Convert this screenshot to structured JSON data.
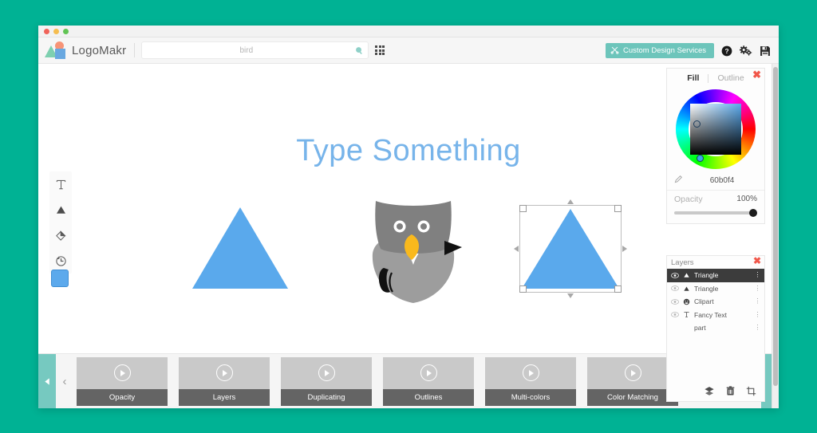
{
  "app": {
    "name": "LogoMakr",
    "window_controls": [
      "close",
      "minimize",
      "maximize"
    ]
  },
  "header": {
    "logo_text": "LogoMakr",
    "search": {
      "value": "bird",
      "placeholder": "bird"
    },
    "search_icon": "search-icon",
    "grid_icon": "grid-icon",
    "cds_button": {
      "label": "Custom Design Services",
      "icon": "scissors-icon",
      "color": "#6dc5bb"
    },
    "help_icon": "help-icon",
    "settings_icon": "gears-icon",
    "save_icon": "save-icon"
  },
  "toolbar": {
    "tools": [
      {
        "name": "text-tool",
        "glyph": "T"
      },
      {
        "name": "shapes-tool",
        "glyph": "triangle"
      },
      {
        "name": "fill-tool",
        "glyph": "paint"
      },
      {
        "name": "history-tool",
        "glyph": "clock"
      }
    ],
    "color_swatch": "#5ca9ec"
  },
  "canvas": {
    "heading": "Type Something",
    "heading_color": "#77b4ea",
    "shapes": [
      {
        "name": "triangle-left",
        "type": "triangle",
        "fill": "#5aa9ec",
        "selected": false
      },
      {
        "name": "owl-clipart",
        "type": "clipart",
        "fill": "#808080",
        "selected": false
      },
      {
        "name": "triangle-selected",
        "type": "triangle",
        "fill": "#5aa9ec",
        "selected": true
      }
    ]
  },
  "color_panel": {
    "tab_fill": "Fill",
    "tab_outline": "Outline",
    "active_tab": "Fill",
    "hex": "60b0f4",
    "opacity_label": "Opacity",
    "opacity_value": "100%",
    "close_label": "✖",
    "eyedropper_icon": "eyedropper-icon"
  },
  "layers_panel": {
    "title": "Layers",
    "close_label": "✖",
    "items": [
      {
        "name": "Triangle",
        "icon": "triangle-icon",
        "visible": true,
        "active": true
      },
      {
        "name": "Triangle",
        "icon": "triangle-icon",
        "visible": true,
        "active": false
      },
      {
        "name": "Clipart",
        "icon": "clipart-icon",
        "visible": true,
        "active": false
      },
      {
        "name": "Fancy Text",
        "icon": "text-icon",
        "visible": true,
        "active": false
      },
      {
        "name": "part",
        "icon": "clipart-icon",
        "visible": true,
        "active": false
      }
    ],
    "footer_icons": [
      "layers-stack-icon",
      "trash-icon",
      "crop-icon"
    ]
  },
  "tutorials": {
    "prev_label": "‹",
    "next_label": "›",
    "collapse_label": "◀",
    "cards": [
      {
        "label": "Opacity"
      },
      {
        "label": "Layers"
      },
      {
        "label": "Duplicating"
      },
      {
        "label": "Outlines"
      },
      {
        "label": "Multi-colors"
      },
      {
        "label": "Color Matching"
      }
    ]
  },
  "theme": {
    "page_background": "#00b294",
    "accent_teal": "#6dc5bb",
    "shape_blue": "#5aa9ec"
  }
}
